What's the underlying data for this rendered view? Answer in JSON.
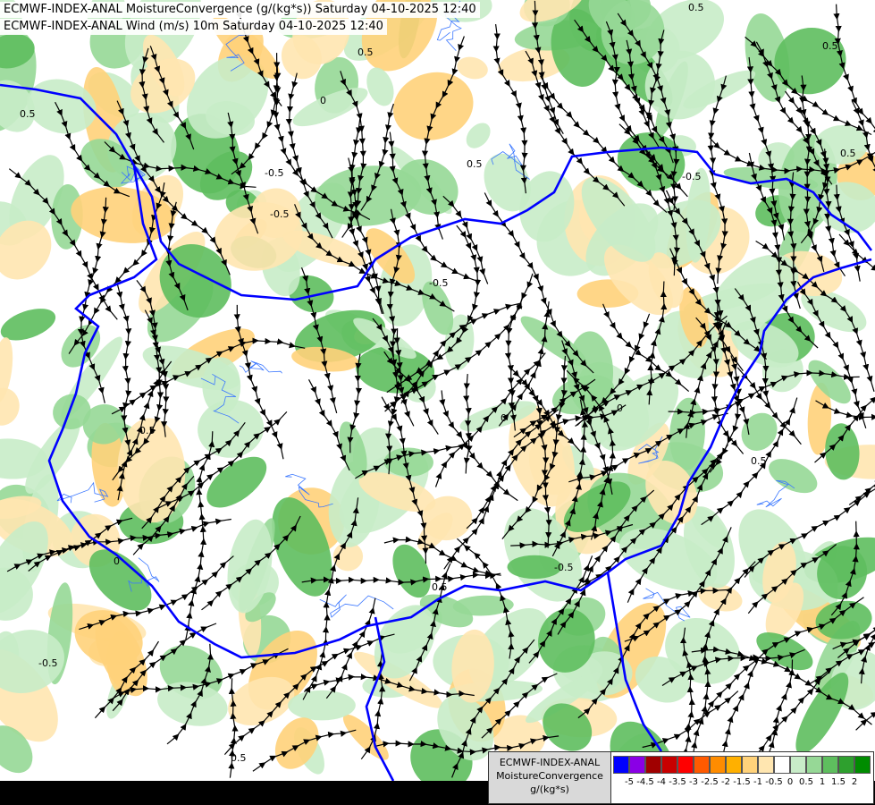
{
  "titles": {
    "line1": "ECMWF-INDEX-ANAL MoistureConvergence (g/(kg*s)) Saturday 04-10-2025 12:40",
    "line2": "ECMWF-INDEX-ANAL Wind (m/s) 10m Saturday 04-10-2025 12:40"
  },
  "legend": {
    "model": "ECMWF-INDEX-ANAL",
    "variable": "MoistureConvergence",
    "unit": "g/(kg*s)",
    "colors": [
      "#0000ff",
      "#8a00e6",
      "#a00000",
      "#c80000",
      "#ff0000",
      "#ff5a00",
      "#ff8c00",
      "#ffb000",
      "#ffd27a",
      "#ffe6b0",
      "#ffffff",
      "#c8ecc8",
      "#96d896",
      "#5ebe5e",
      "#2ea02e",
      "#008c00"
    ],
    "tick_labels": [
      "-5",
      "-4.5",
      "-4",
      "-3.5",
      "-3",
      "-2.5",
      "-2",
      "-1.5",
      "-1",
      "-0.5",
      "0",
      "0.5",
      "1",
      "1.5",
      "2"
    ]
  },
  "contour_labels": [
    {
      "text": "0.5",
      "name": "label-0.5-a"
    },
    {
      "text": "0.5",
      "name": "label-0.5-b"
    },
    {
      "text": "-0.5",
      "name": "label-neg0.5-a"
    },
    {
      "text": "0.5",
      "name": "label-0.5-c"
    },
    {
      "text": "0",
      "name": "label-0-a"
    },
    {
      "text": "-0.5",
      "name": "label-neg0.5-b"
    },
    {
      "text": "0.5",
      "name": "label-0.5-d"
    },
    {
      "text": "0",
      "name": "label-0-b"
    },
    {
      "text": "-0.5",
      "name": "label-neg0.5-c"
    },
    {
      "text": "0.5",
      "name": "label-0.5-e"
    },
    {
      "text": "-0.5",
      "name": "label-neg0.5-d"
    },
    {
      "text": "0.5",
      "name": "label-0.5-f"
    },
    {
      "text": "0.5",
      "name": "label-0.5-g"
    },
    {
      "text": "0",
      "name": "label-0-c"
    },
    {
      "text": "-0.5",
      "name": "label-neg0.5-e"
    },
    {
      "text": "0.5",
      "name": "label-0.5-h"
    },
    {
      "text": "0.5",
      "name": "label-0.5-i"
    },
    {
      "text": "-0.5",
      "name": "label-neg0.5-f"
    },
    {
      "text": "0.5",
      "name": "label-0.5-j"
    },
    {
      "text": "0",
      "name": "label-0-d"
    }
  ],
  "colors": {
    "border": "#0000ff",
    "river": "#3c78ff",
    "streamline": "#000000"
  }
}
